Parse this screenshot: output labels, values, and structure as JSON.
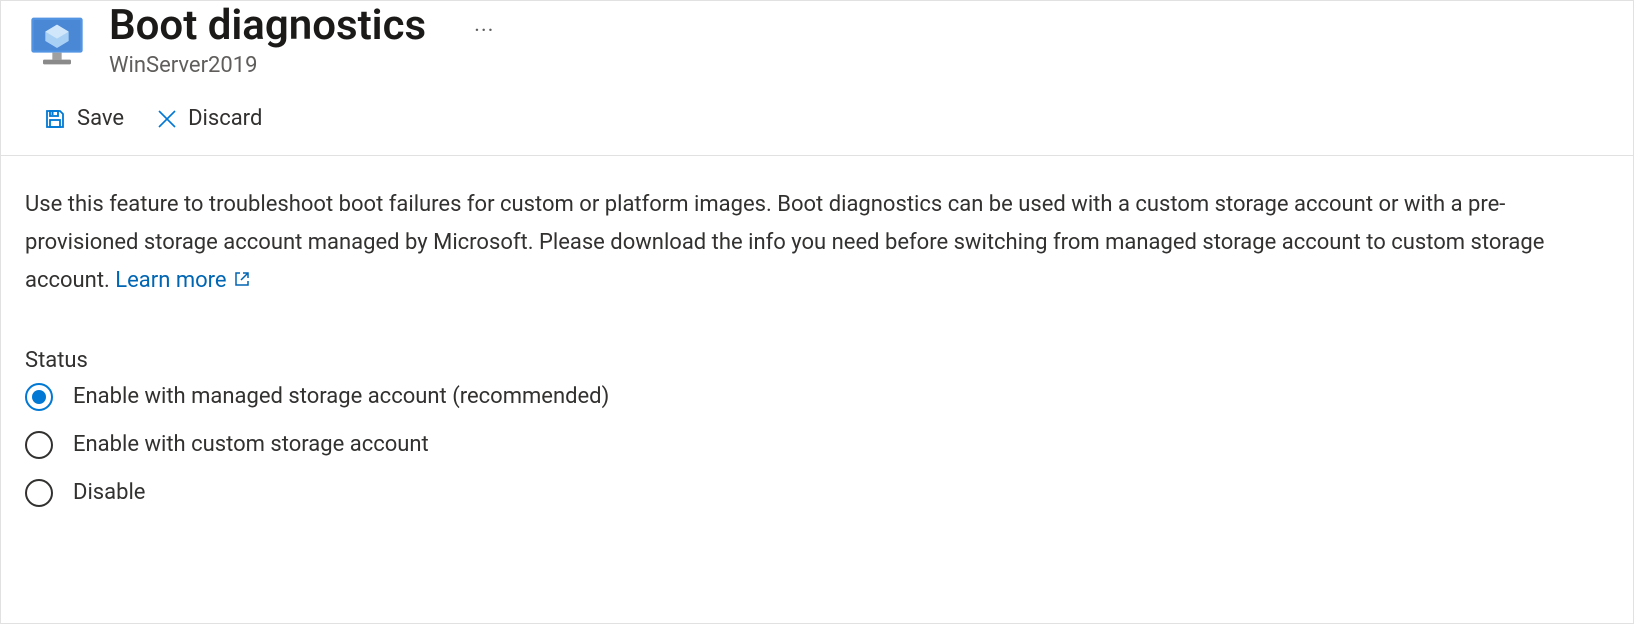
{
  "header": {
    "title": "Boot diagnostics",
    "subtitle": "WinServer2019",
    "more": "···"
  },
  "toolbar": {
    "save_label": "Save",
    "discard_label": "Discard"
  },
  "description": {
    "text": "Use this feature to troubleshoot boot failures for custom or platform images. Boot diagnostics can be used with a custom storage account or with a pre-provisioned storage account managed by Microsoft. Please download the info you need before switching from managed storage account to custom storage account.",
    "link_label": "Learn more"
  },
  "status": {
    "label": "Status",
    "selected": 0,
    "options": [
      "Enable with managed storage account (recommended)",
      "Enable with custom storage account",
      "Disable"
    ]
  },
  "colors": {
    "accent": "#0078d4",
    "link": "#0065b3"
  }
}
